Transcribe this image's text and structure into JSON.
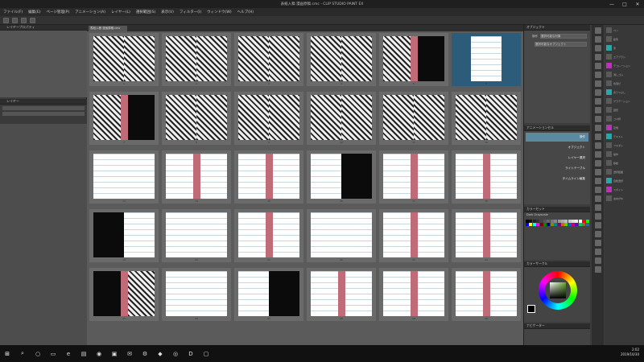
{
  "window": {
    "title": "表紙入稿 漫画原稿.cmc - CLIP STUDIO PAINT EX",
    "controls": [
      "—",
      "□",
      "✕"
    ]
  },
  "menu": [
    "ファイル(F)",
    "編集(E)",
    "ページ管理(P)",
    "アニメーション(A)",
    "レイヤー(L)",
    "選択範囲(S)",
    "表示(V)",
    "フィルター(I)",
    "ウィンドウ(W)",
    "ヘルプ(H)"
  ],
  "left_panel": {
    "top_title": "レイヤープロパティ",
    "bottom_title": "レイヤー"
  },
  "canvas": {
    "tab_label": "表紙入稿 漫画原稿.cmc"
  },
  "pages": [
    {
      "num": "1",
      "style": [
        "art",
        "art"
      ],
      "gutter": false
    },
    {
      "num": "2",
      "style": [
        "art",
        "art"
      ],
      "gutter": false
    },
    {
      "num": "3",
      "style": [
        "art",
        "art"
      ],
      "gutter": false
    },
    {
      "num": "4",
      "style": [
        "art",
        "art"
      ],
      "gutter": false
    },
    {
      "num": "5",
      "style": [
        "art",
        "dark"
      ],
      "gutter": true
    },
    {
      "num": "6",
      "style": [
        "light"
      ],
      "gutter": false,
      "selected": true
    },
    {
      "num": "7",
      "style": [
        "art",
        "dark"
      ],
      "gutter": true
    },
    {
      "num": "8",
      "style": [
        "art",
        "art"
      ],
      "gutter": false
    },
    {
      "num": "9",
      "style": [
        "art",
        "art"
      ],
      "gutter": false
    },
    {
      "num": "10",
      "style": [
        "art",
        "art"
      ],
      "gutter": false
    },
    {
      "num": "11",
      "style": [
        "art",
        "art"
      ],
      "gutter": false
    },
    {
      "num": "12",
      "style": [
        "art",
        "art"
      ],
      "gutter": false
    },
    {
      "num": "13",
      "style": [
        "light",
        "light"
      ],
      "gutter": false
    },
    {
      "num": "14",
      "style": [
        "light",
        "light"
      ],
      "gutter": true
    },
    {
      "num": "15",
      "style": [
        "light",
        "light"
      ],
      "gutter": true
    },
    {
      "num": "16",
      "style": [
        "light",
        "dark"
      ],
      "gutter": false
    },
    {
      "num": "17",
      "style": [
        "light",
        "light"
      ],
      "gutter": true
    },
    {
      "num": "18",
      "style": [
        "light",
        "light"
      ],
      "gutter": true
    },
    {
      "num": "19",
      "style": [
        "dark",
        "light"
      ],
      "gutter": false
    },
    {
      "num": "20",
      "style": [
        "light",
        "light"
      ],
      "gutter": false
    },
    {
      "num": "21",
      "style": [
        "light",
        "light"
      ],
      "gutter": true
    },
    {
      "num": "22",
      "style": [
        "light",
        "light"
      ],
      "gutter": false
    },
    {
      "num": "23",
      "style": [
        "light",
        "light"
      ],
      "gutter": true
    },
    {
      "num": "24",
      "style": [
        "light",
        "light"
      ],
      "gutter": true
    },
    {
      "num": "25",
      "style": [
        "dark",
        "art"
      ],
      "gutter": true
    },
    {
      "num": "26",
      "style": [
        "light",
        "light"
      ],
      "gutter": false
    },
    {
      "num": "27",
      "style": [
        "light",
        "dark"
      ],
      "gutter": false
    },
    {
      "num": "28",
      "style": [
        "light",
        "light"
      ],
      "gutter": true
    },
    {
      "num": "29",
      "style": [
        "light",
        "light"
      ],
      "gutter": true
    },
    {
      "num": "30",
      "style": [
        "light",
        "light"
      ],
      "gutter": true
    }
  ],
  "right_panel": {
    "object_title": "オブジェクト",
    "object_rows": [
      {
        "label": "操作",
        "value": "選択可能な対象"
      },
      {
        "label": "",
        "value": "選択可能なオブジェクト"
      }
    ],
    "anim_title": "アニメーションセル",
    "anim_items": [
      "操作",
      "オブジェクト",
      "レイヤー選択",
      "ライトテーブル",
      "タイムライン編集"
    ],
    "color_set_title": "カラーセット",
    "color_set_name": "Dark Grayscale",
    "color_wheel_title": "カラーサークル",
    "nav_title": "ナビゲーター",
    "tool_labels": [
      "ペン",
      "鉛筆",
      "筆",
      "エアブラシ",
      "デコレーション",
      "消しゴム",
      "色混ぜ",
      "塗りつぶし",
      "グラデーション",
      "図形",
      "コマ枠",
      "定規",
      "テキスト",
      "フキダシ",
      "操作",
      "移動",
      "選択範囲",
      "自動選択",
      "スポイト",
      "虫めがね"
    ]
  },
  "colors": {
    "gutter": "#c06b78",
    "selected": "#2d5b7a",
    "accent": "#5b8aa0"
  },
  "swatches": [
    "#000",
    "#111",
    "#222",
    "#333",
    "#444",
    "#555",
    "#666",
    "#777",
    "#888",
    "#999",
    "#aaa",
    "#bbb",
    "#ccc",
    "#ddd",
    "#eee",
    "#fff",
    "#f00",
    "#0f0",
    "#00f",
    "#ff0",
    "#0ff",
    "#f0f",
    "#800",
    "#080",
    "#008",
    "#880",
    "#088",
    "#808",
    "#c60",
    "#6c0",
    "#06c",
    "#c06",
    "#60c",
    "#0c6",
    "#963",
    "#369"
  ],
  "taskbar": {
    "icons": [
      "windows-icon",
      "search-icon",
      "cortana-icon",
      "task-view-icon",
      "edge-icon",
      "explorer-icon",
      "chrome-icon",
      "store-icon",
      "mail-icon",
      "settings-icon",
      "app-icon",
      "clip-icon",
      "d-icon",
      "monitor-icon"
    ],
    "time": "2:02",
    "date": "2019/10/30"
  }
}
